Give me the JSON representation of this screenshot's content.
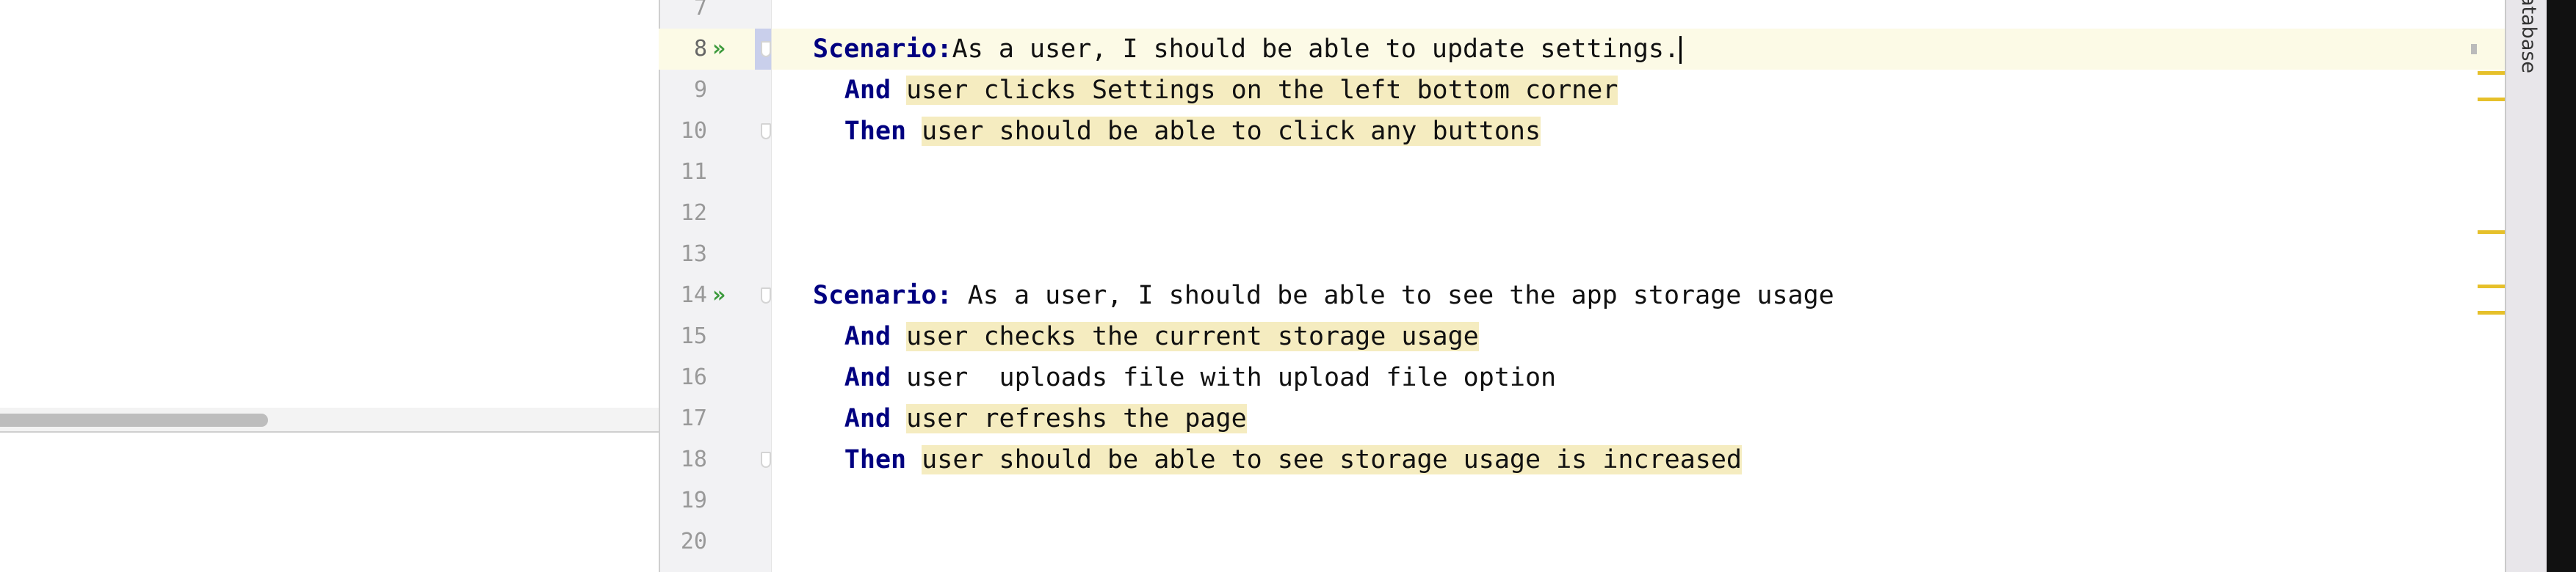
{
  "right_toolwindow": {
    "label": "atabase"
  },
  "editor": {
    "current_line": 8,
    "lines": [
      {
        "num": "7"
      },
      {
        "num": "8",
        "run": true,
        "keyword": "Scenario:",
        "text": "As a user, I should be able to update settings.",
        "highlight": false,
        "indent": 0,
        "caret": true
      },
      {
        "num": "9",
        "keyword": "And",
        "text": "user clicks Settings on the left bottom corner",
        "highlight": true,
        "indent": 2
      },
      {
        "num": "10",
        "keyword": "Then",
        "text": "user should be able to click any buttons",
        "highlight": true,
        "indent": 2
      },
      {
        "num": "11"
      },
      {
        "num": "12"
      },
      {
        "num": "13"
      },
      {
        "num": "14",
        "run": true,
        "keyword": "Scenario:",
        "text": " As a user, I should be able to see the app storage usage",
        "highlight": false,
        "indent": 0
      },
      {
        "num": "15",
        "keyword": "And",
        "text": "user checks the current storage usage",
        "highlight": true,
        "indent": 2
      },
      {
        "num": "16",
        "keyword": "And",
        "text": "user  uploads file with upload file option",
        "highlight": false,
        "indent": 2
      },
      {
        "num": "17",
        "keyword": "And",
        "text": "user refreshs the page",
        "highlight": true,
        "indent": 2
      },
      {
        "num": "18",
        "keyword": "Then",
        "text": "user should be able to see storage usage is increased",
        "highlight": true,
        "indent": 2
      },
      {
        "num": "19"
      },
      {
        "num": "20"
      }
    ]
  },
  "icons": {
    "run": "run-scenario-icon",
    "fold": "fold-icon"
  },
  "colors": {
    "keyword": "#000080",
    "step_highlight": "#f5ecc0",
    "current_line": "#fcfae6",
    "warning_stripe": "#e6c02a"
  }
}
